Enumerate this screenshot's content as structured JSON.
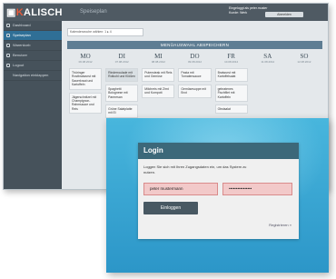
{
  "brand": {
    "logo_prefix": "▣",
    "logo_k": "K",
    "logo_rest": "ALISCH"
  },
  "back_window": {
    "title": "Speiseplan",
    "top_info": [
      "Eingeloggt als peter.muster",
      "Kunde: Werk"
    ],
    "top_button": "Abmelden",
    "sidebar": [
      {
        "label": "Dashboard",
        "active": false
      },
      {
        "label": "Speiseplan",
        "active": true
      },
      {
        "label": "Warenkorb",
        "active": false
      },
      {
        "label": "Benutzer",
        "active": false
      },
      {
        "label": "Logout",
        "active": false
      },
      {
        "label": "Navigation einklappen",
        "active": false
      }
    ],
    "filter_text": "Kalenderwoche wählen: 1 ▸ 4",
    "banner": "MENÜAUSWAHL ABSPEICHERN",
    "days": [
      {
        "name": "MO",
        "date": "06.08.2012"
      },
      {
        "name": "DI",
        "date": "07.08.2012"
      },
      {
        "name": "MI",
        "date": "08.08.2012"
      },
      {
        "name": "DO",
        "date": "09.08.2012"
      },
      {
        "name": "FR",
        "date": "10.08.2012"
      },
      {
        "name": "SA",
        "date": "11.08.2012"
      },
      {
        "name": "SO",
        "date": "12.08.2012"
      }
    ],
    "columns": [
      [
        "Thüringer Rostbratwurst mit Sauerkraut und Kartoffeln",
        "Jägerschnitzel mit Champignon-Rahmsauce und Reis"
      ],
      [
        "Rinderroulade mit Rotkohl und Klößen",
        "Spaghetti Bolognese mit Parmesan",
        "Grüne Salatplatte mit Ei"
      ],
      [
        "Putensteak mit Reis und Gemüse",
        "Milchreis mit Zimt und Kompott"
      ],
      [
        "Pasta mit Tomatensauce",
        "Gemüsesuppe mit Brot"
      ],
      [
        "Bratwurst mit Kartoffelsalat",
        "gebratenes Fischfilet mit Kartoffeln",
        "Obstsalat"
      ],
      [],
      []
    ]
  },
  "login": {
    "title": "Login",
    "instruction": "Loggen Sie sich mit Ihren Zugangsdaten ein, um das System zu nutzen.",
    "username_value": "peter mustermann",
    "password_value": "••••••••••••••••",
    "login_button": "Einloggen",
    "register_link": "Registrieren »"
  },
  "colors": {
    "header_dark": "#4f5a63",
    "sidebar": "#46525b",
    "active": "#2f6f96",
    "login_bg": "#2c96c8",
    "panel_head": "#3c6879",
    "field_error": "#f2c9c9"
  }
}
